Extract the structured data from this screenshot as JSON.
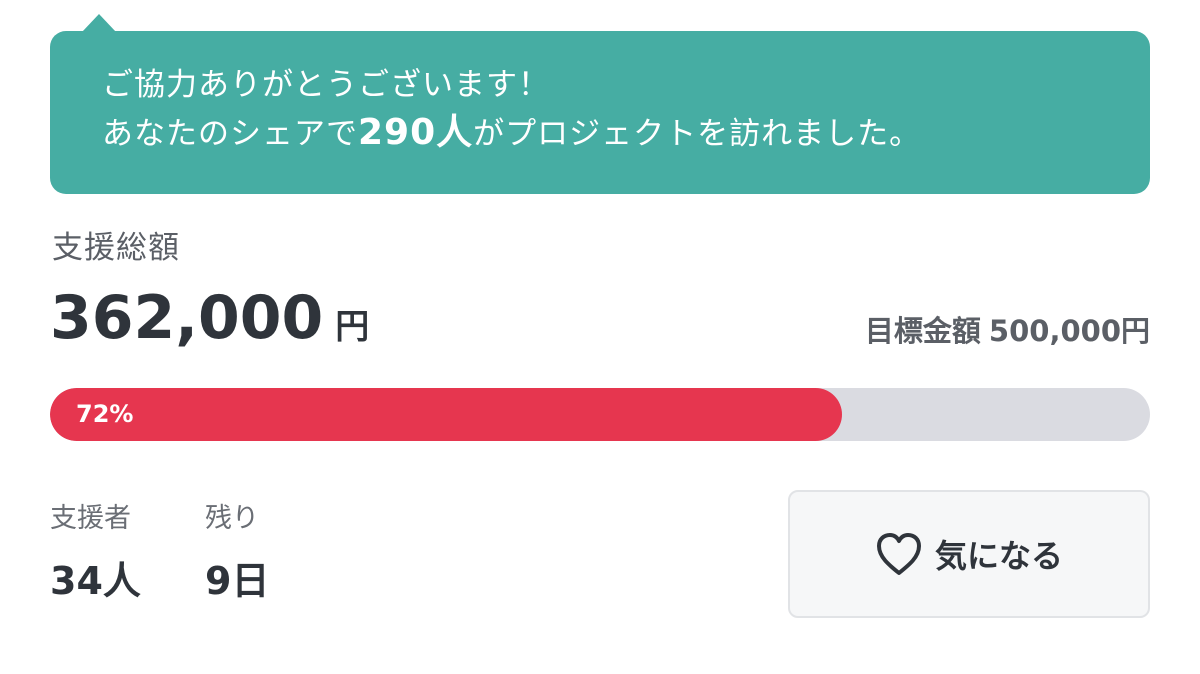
{
  "share_banner": {
    "line1": "ご協力ありがとうございます！",
    "line2_prefix": "あなたのシェアで",
    "line2_count": "290人",
    "line2_suffix": "がプロジェクトを訪れました。"
  },
  "funding": {
    "total_label": "支援総額",
    "total_value": "362,000",
    "total_unit": "円",
    "goal_label": "目標金額",
    "goal_value": "500,000円",
    "progress_percent": 72,
    "progress_text": "72%"
  },
  "stats": {
    "supporters_label": "支援者",
    "supporters_value": "34人",
    "remaining_label": "残り",
    "remaining_value": "9日"
  },
  "favorite": {
    "icon": "heart-icon",
    "label": "気になる"
  },
  "colors": {
    "banner": "#46ada3",
    "progress_fill": "#e6364f",
    "progress_track": "#dadbe1"
  }
}
